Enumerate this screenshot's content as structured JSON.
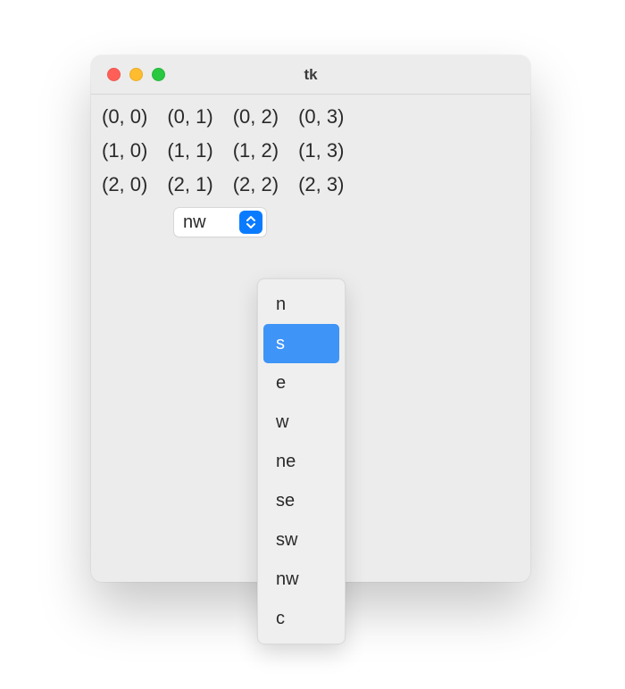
{
  "window": {
    "title": "tk"
  },
  "grid": {
    "rows": [
      [
        "(0, 0)",
        "(0, 1)",
        "(0, 2)",
        "(0, 3)"
      ],
      [
        "(1, 0)",
        "(1, 1)",
        "(1, 2)",
        "(1, 3)"
      ],
      [
        "(2, 0)",
        "(2, 1)",
        "(2, 2)",
        "(2, 3)"
      ]
    ]
  },
  "combobox": {
    "value": "nw",
    "options": [
      "n",
      "s",
      "e",
      "w",
      "ne",
      "se",
      "sw",
      "nw",
      "c"
    ],
    "highlighted_index": 1
  }
}
